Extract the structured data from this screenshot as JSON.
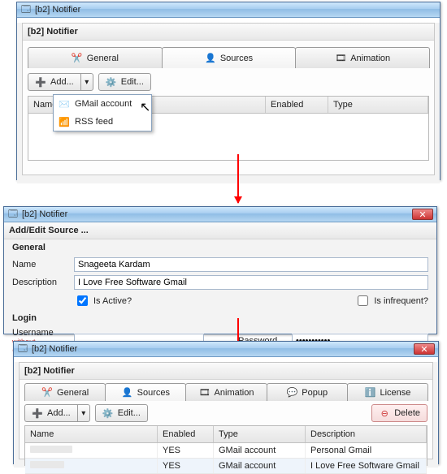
{
  "app_title": "[b2] Notifier",
  "win1": {
    "panel_title": "[b2] Notifier",
    "tabs": [
      "General",
      "Sources",
      "Animation"
    ],
    "add_label": "Add...",
    "edit_label": "Edit...",
    "dropdown": {
      "gmail": "GMail account",
      "rss": "RSS feed"
    },
    "cols": {
      "name": "Name",
      "enabled": "Enabled",
      "type": "Type"
    }
  },
  "win2": {
    "title": "Add/Edit Source ...",
    "sec_general": "General",
    "name_lbl": "Name",
    "name_val": "Snageeta Kardam",
    "desc_lbl": "Description",
    "desc_val": "I Love Free Software Gmail",
    "active_lbl": "Is Active?",
    "active_checked": true,
    "infreq_lbl": "Is infrequent?",
    "infreq_checked": false,
    "sec_login": "Login",
    "user_lbl": "Username",
    "user_note": "without @gmail.com",
    "user_val": "",
    "pass_lbl": "Password",
    "pass_val": "***********"
  },
  "win3": {
    "panel_title": "[b2] Notifier",
    "tabs": [
      "General",
      "Sources",
      "Animation",
      "Popup",
      "License"
    ],
    "add_label": "Add...",
    "edit_label": "Edit...",
    "delete_label": "Delete",
    "cols": {
      "name": "Name",
      "enabled": "Enabled",
      "type": "Type",
      "desc": "Description"
    },
    "rows": [
      {
        "name": "",
        "enabled": "YES",
        "type": "GMail account",
        "desc": "Personal Gmail"
      },
      {
        "name": "",
        "enabled": "YES",
        "type": "GMail account",
        "desc": "I Love Free Software Gmail"
      }
    ]
  }
}
